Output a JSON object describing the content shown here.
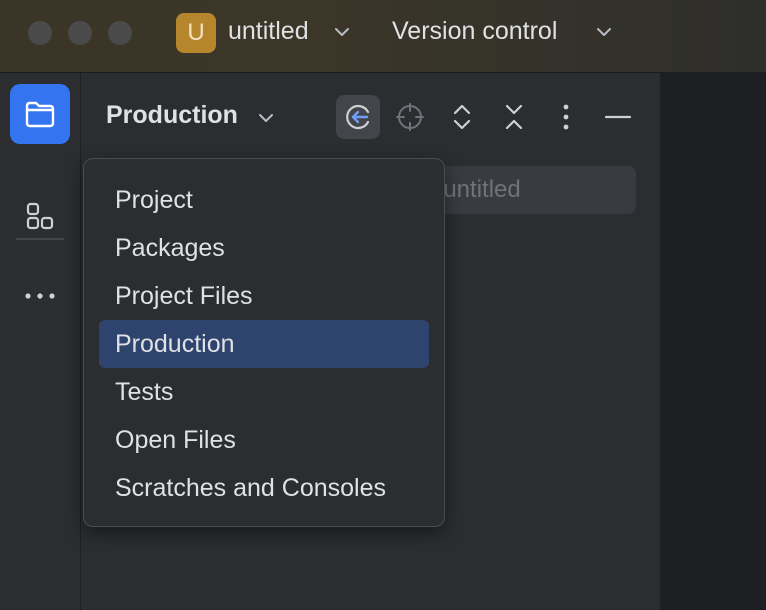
{
  "titlebar": {
    "project_badge": "U",
    "project_name": "untitled",
    "vcs_label": "Version control"
  },
  "panel": {
    "title": "Production",
    "path_text": "cts/untitled"
  },
  "dropdown": {
    "items": [
      {
        "label": "Project"
      },
      {
        "label": "Packages"
      },
      {
        "label": "Project Files"
      },
      {
        "label": "Production"
      },
      {
        "label": "Tests"
      },
      {
        "label": "Open Files"
      },
      {
        "label": "Scratches and Consoles"
      }
    ],
    "selected": "Production"
  },
  "colors": {
    "accent": "#3574f0",
    "selection": "#2e436e",
    "project_badge": "#b5862b"
  }
}
